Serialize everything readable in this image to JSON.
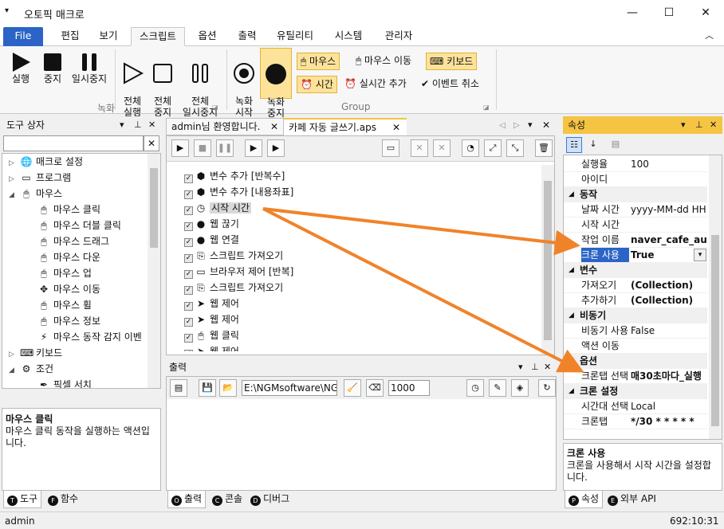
{
  "window": {
    "title": "오토픽 매크로",
    "minimize": "—",
    "maximize": "☐",
    "close": "✕"
  },
  "menu_tabs": [
    "File",
    "편집",
    "보기",
    "스크립트",
    "옵션",
    "출력",
    "유틸리티",
    "시스템",
    "관리자"
  ],
  "ribbon": {
    "record": {
      "run": "실행",
      "stop": "중지",
      "pause": "일시중지",
      "run_all": "전체\n실행",
      "stop_all": "전체\n중지",
      "pause_all": "전체\n일시중지",
      "group_label": "녹화"
    },
    "group": {
      "rec_start": "녹화\n시작",
      "rec_stop": "녹화\n중지",
      "mouse": "마우스",
      "mouse_move": "마우스 이동",
      "keyboard": "키보드",
      "time": "시간",
      "realtime_add": "실시간 추가",
      "event_cancel": "이벤트 취소",
      "group_label": "Group"
    }
  },
  "toolbox": {
    "title": "도구 상자",
    "search_placeholder": "",
    "items": [
      {
        "label": "매크로 설정",
        "icon": "globe-icon",
        "level": 0,
        "exp": "▷"
      },
      {
        "label": "프로그램",
        "icon": "monitor-icon",
        "level": 0,
        "exp": "▷"
      },
      {
        "label": "마우스",
        "icon": "mouse-icon",
        "level": 0,
        "exp": "◢"
      },
      {
        "label": "마우스 클릭",
        "icon": "mouse-click-icon",
        "level": 1
      },
      {
        "label": "마우스 더블 클릭",
        "icon": "mouse-double-click-icon",
        "level": 1
      },
      {
        "label": "마우스 드래그",
        "icon": "mouse-drag-icon",
        "level": 1
      },
      {
        "label": "마우스 다운",
        "icon": "mouse-down-icon",
        "level": 1
      },
      {
        "label": "마우스 업",
        "icon": "mouse-up-icon",
        "level": 1
      },
      {
        "label": "마우스 이동",
        "icon": "move-icon",
        "level": 1
      },
      {
        "label": "마우스 휠",
        "icon": "mouse-wheel-icon",
        "level": 1
      },
      {
        "label": "마우스 정보",
        "icon": "mouse-info-icon",
        "level": 1
      },
      {
        "label": "마우스 동작 감지 이벤",
        "icon": "lightning-icon",
        "level": 1
      },
      {
        "label": "키보드",
        "icon": "keyboard-icon",
        "level": 0,
        "exp": "▷"
      },
      {
        "label": "조건",
        "icon": "condition-icon",
        "level": 0,
        "exp": "◢"
      },
      {
        "label": "픽셀 서치",
        "icon": "eyedropper-icon",
        "level": 1
      }
    ],
    "desc_title": "마우스 클릭",
    "desc_text": "마우스 클릭 동작을 실행하는 액션입니다.",
    "tabs": [
      "도구",
      "함수"
    ]
  },
  "editor": {
    "tabs": [
      "admin님 환영합니다.",
      "카페 자동 글쓰기.aps"
    ],
    "rows": [
      {
        "label": "변수 추가 [반복수]",
        "icon": "cube-icon"
      },
      {
        "label": "변수 추가 [내용좌표]",
        "icon": "cube-icon"
      },
      {
        "label": "시작 시간",
        "icon": "clock-24-icon",
        "selected": true
      },
      {
        "label": "웹 끊기",
        "icon": "web-disconnect-icon"
      },
      {
        "label": "웹 연결",
        "icon": "web-connect-icon"
      },
      {
        "label": "스크립트 가져오기",
        "icon": "script-import-icon"
      },
      {
        "label": "브라우저 제어 [반복]",
        "icon": "browser-icon"
      },
      {
        "label": "스크립트 가져오기",
        "icon": "script-import-icon"
      },
      {
        "label": "웹 제어",
        "icon": "web-control-icon"
      },
      {
        "label": "웹 제어",
        "icon": "web-control-icon"
      },
      {
        "label": "웹 클릭",
        "icon": "web-click-icon"
      },
      {
        "label": "웹 제어",
        "icon": "web-control-icon"
      }
    ]
  },
  "output": {
    "title": "출력",
    "path": "E:\\NGMsoftware\\NG",
    "number": "1000",
    "tabs": [
      "출력",
      "콘솔",
      "디버그"
    ]
  },
  "properties": {
    "title": "속성",
    "rows": [
      {
        "type": "prop",
        "k": "실행율",
        "v": "100"
      },
      {
        "type": "prop",
        "k": "아이디",
        "v": ""
      },
      {
        "type": "cat",
        "k": "동작"
      },
      {
        "type": "prop",
        "k": "날짜 시간",
        "v": "yyyy-MM-dd HH:"
      },
      {
        "type": "prop",
        "k": "시작 시간",
        "v": ""
      },
      {
        "type": "prop",
        "k": "작업 이름",
        "v": "naver_cafe_auto_",
        "bold": true
      },
      {
        "type": "prop",
        "k": "크론 사용",
        "v": "True",
        "bold": true,
        "selected": true,
        "dropdown": true
      },
      {
        "type": "cat",
        "k": "변수"
      },
      {
        "type": "prop",
        "k": "가져오기",
        "v": "(Collection)",
        "bold": true
      },
      {
        "type": "prop",
        "k": "추가하기",
        "v": "(Collection)",
        "bold": true
      },
      {
        "type": "cat",
        "k": "비동기"
      },
      {
        "type": "prop",
        "k": "비동기 사용",
        "v": "False"
      },
      {
        "type": "prop",
        "k": "액션 이동",
        "v": ""
      },
      {
        "type": "cat",
        "k": "옵션"
      },
      {
        "type": "prop",
        "k": "크론탭 선택",
        "v": "매30초마다_실행",
        "bold": true
      },
      {
        "type": "cat",
        "k": "크론 설정"
      },
      {
        "type": "prop",
        "k": "시간대 선택",
        "v": "Local"
      },
      {
        "type": "prop",
        "k": "크론탭",
        "v": "*/30 * * * * *",
        "bold": true
      }
    ],
    "desc_title": "크론 사용",
    "desc_text": "크론을 사용해서 시작 시간을 설정합니다.",
    "tabs": [
      "속성",
      "외부 API"
    ]
  },
  "status": {
    "user": "admin",
    "time": "692:10:31"
  },
  "colors": {
    "accent": "#2b64c6",
    "active_panel": "#f5c443",
    "highlight": "#fde39a",
    "arrow": "#f0832a",
    "selection": "#2b64c6"
  }
}
